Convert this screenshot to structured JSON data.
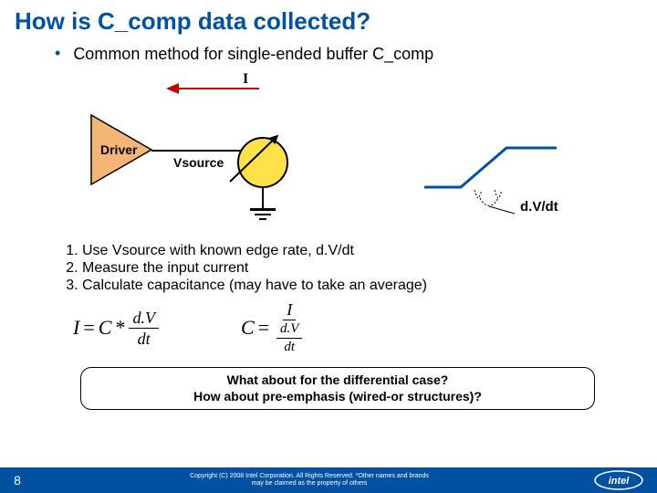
{
  "title": "How is C_comp data collected?",
  "bullet": "Common method for single-ended buffer C_comp",
  "diagram": {
    "driver_label": "Driver",
    "i_label": "I",
    "vsource_label": "Vsource",
    "dvdt_label": "d.V/dt"
  },
  "steps": [
    "Use Vsource with known edge rate, d.V/dt",
    "Measure the input current",
    "Calculate capacitance (may have to take an average)"
  ],
  "formula1": {
    "lhs": "I",
    "eq": "=",
    "c": "C",
    "star": "*",
    "num": "d.V",
    "den": "dt"
  },
  "formula2": {
    "lhs": "C",
    "eq": "=",
    "outer_num": "I",
    "inner_num": "d.V",
    "inner_den": "dt"
  },
  "question": {
    "line1": "What about for the differential case?",
    "line2": "How about pre-emphasis (wired-or structures)?"
  },
  "footer": {
    "page": "8",
    "copyright_line1": "Copyright (C) 2008 Intel Corporation.  All Rights Reserved. *Other names and brands",
    "copyright_line2": "may be claimed as the property of others"
  }
}
